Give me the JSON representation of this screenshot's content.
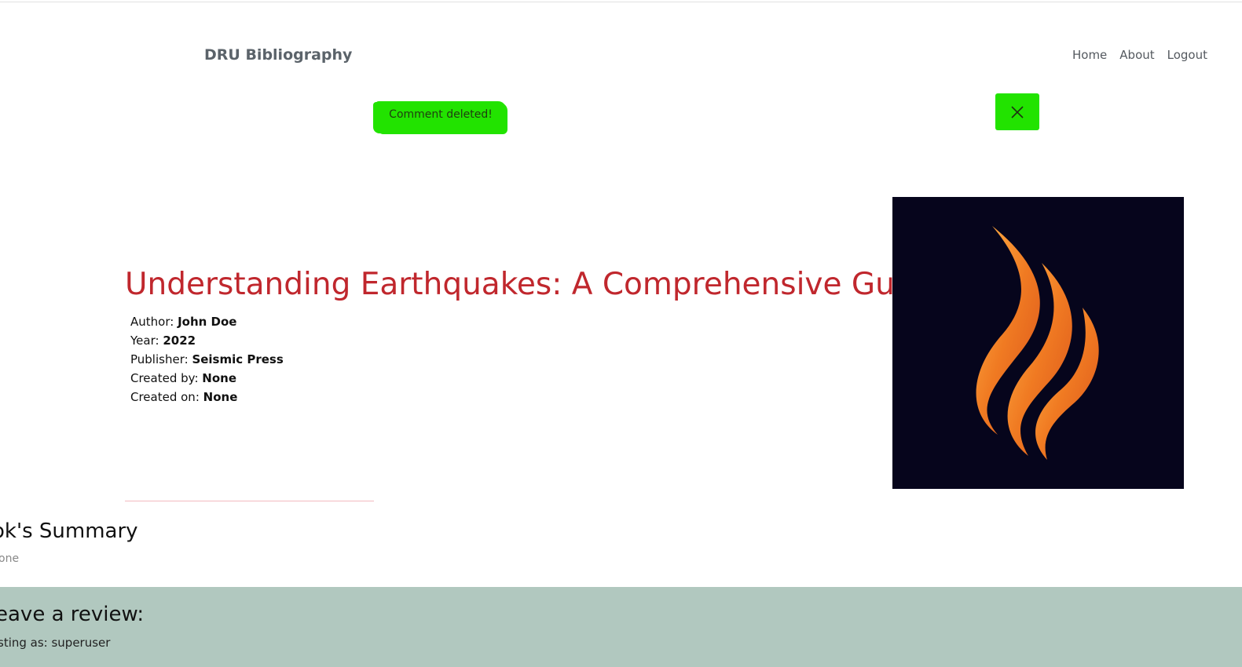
{
  "header": {
    "brand": "DRU Bibliography",
    "nav": [
      {
        "label": "Home"
      },
      {
        "label": "About"
      },
      {
        "label": "Logout"
      }
    ]
  },
  "alert": {
    "message": "Comment deleted!",
    "close_icon": "close-icon",
    "color": "#22e300"
  },
  "book": {
    "title": "Understanding Earthquakes: A Comprehensive Guide",
    "title_color": "#c0272d",
    "meta": [
      {
        "label": "Author:",
        "value": "John Doe"
      },
      {
        "label": "Year:",
        "value": "2022"
      },
      {
        "label": "Publisher:",
        "value": "Seismic Press"
      },
      {
        "label": "Created by:",
        "value": "None"
      },
      {
        "label": "Created on:",
        "value": "None"
      }
    ],
    "cover_icon": "flame-logo",
    "cover_background": "#06051c"
  },
  "summary": {
    "heading": "ok's Summary",
    "text": "one"
  },
  "review": {
    "heading": "eave a review:",
    "posting_as": "sting as: superuser",
    "background": "#b1c8bf"
  }
}
